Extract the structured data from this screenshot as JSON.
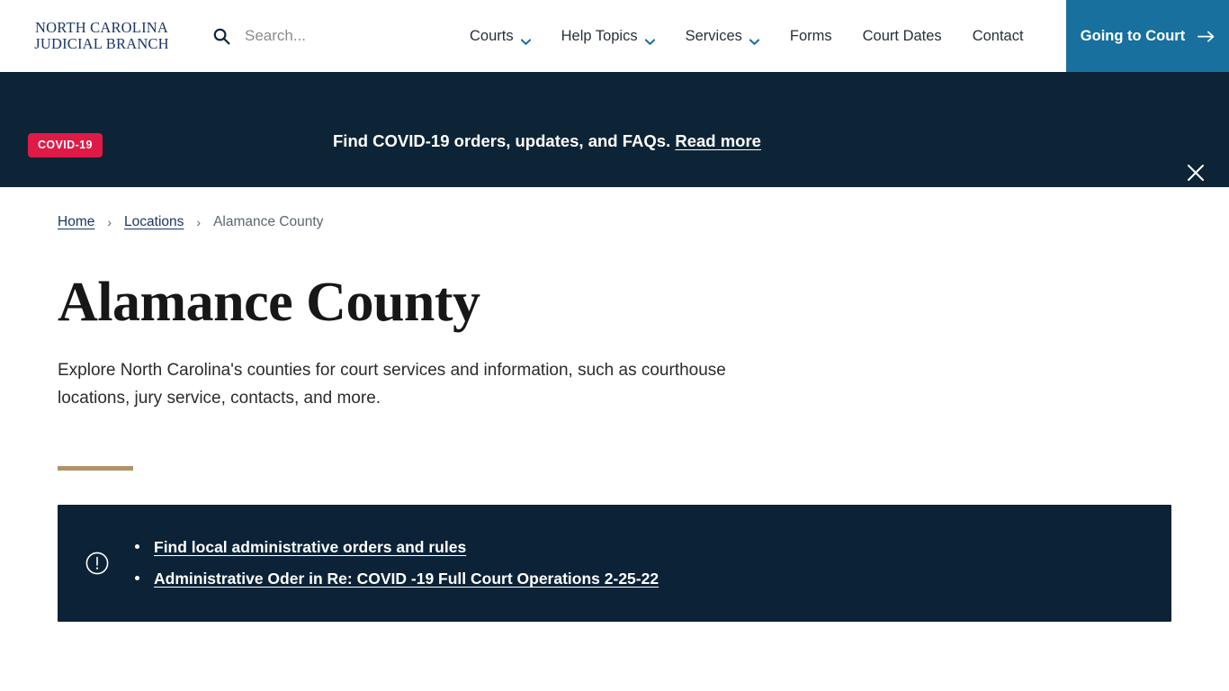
{
  "header": {
    "logo": {
      "line1": "NORTH CAROLINA",
      "line2": "JUDICIAL BRANCH",
      "color": "#1b3666"
    },
    "search": {
      "icon": "search-icon",
      "placeholder": "Search...",
      "value": ""
    },
    "nav": [
      {
        "label": "Courts",
        "has_dropdown": true
      },
      {
        "label": "Help Topics",
        "has_dropdown": true
      },
      {
        "label": "Services",
        "has_dropdown": true
      },
      {
        "label": "Forms",
        "has_dropdown": false
      },
      {
        "label": "Court Dates",
        "has_dropdown": false
      },
      {
        "label": "Contact",
        "has_dropdown": false
      }
    ],
    "cta": {
      "label": "Going to Court",
      "icon": "arrow-right-icon",
      "background": "#17709e"
    }
  },
  "banner": {
    "background": "#0d2436",
    "badge": {
      "label": "COVID-19",
      "background": "#e01a47"
    },
    "message": "Find COVID-19 orders, updates, and FAQs.",
    "link_label": "Read more",
    "close_icon": "close-icon"
  },
  "breadcrumb": {
    "items": [
      {
        "label": "Home",
        "current": false
      },
      {
        "label": "Locations",
        "current": false
      },
      {
        "label": "Alamance County",
        "current": true
      }
    ],
    "separator": "›"
  },
  "page": {
    "title": "Alamance County",
    "lede": "Explore North Carolina's counties for court services and information, such as courthouse locations, jury service, contacts, and more.",
    "rule_color": "#b0936b"
  },
  "alert": {
    "background": "#0b2237",
    "icon": "exclamation-circle-icon",
    "links": [
      "Find local administrative orders and rules",
      "Administrative Oder in Re: COVID -19 Full Court Operations 2-25-22"
    ]
  }
}
